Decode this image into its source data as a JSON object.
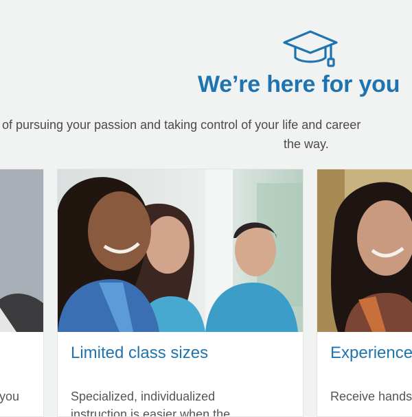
{
  "section": {
    "icon": "graduation-cap-icon",
    "heading": "We’re here for you",
    "subtitle_line1": "of pursuing your passion and taking control of your life and career",
    "subtitle_line2": "the way."
  },
  "cards": [
    {
      "title": "",
      "text": "you"
    },
    {
      "title": "Limited class sizes",
      "text": "Specialized, individualized",
      "text2": "instruction is easier when the"
    },
    {
      "title": "Experienced",
      "text": "Receive hands-on"
    }
  ],
  "colors": {
    "accent": "#1f74b0",
    "background": "#f1f2f2",
    "card": "#ffffff",
    "body_text": "#4a4a4a"
  }
}
